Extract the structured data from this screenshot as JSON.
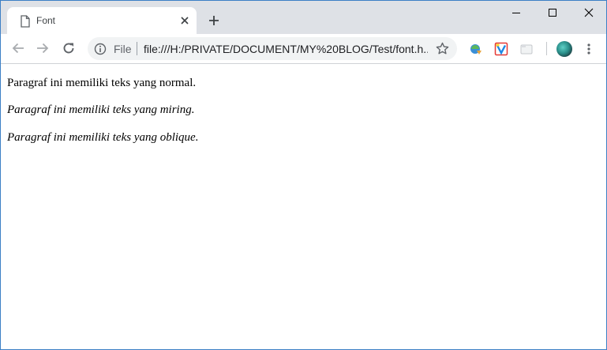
{
  "tab": {
    "title": "Font",
    "favicon": "document-icon"
  },
  "window_controls": [
    "minimize-icon",
    "maximize-icon",
    "close-icon"
  ],
  "toolbar": {
    "buttons": [
      "back-arrow-icon",
      "forward-arrow-icon",
      "reload-icon"
    ],
    "scheme_label": "File",
    "url": "file:///H:/PRIVATE/DOCUMENT/MY%20BLOG/Test/font.h...",
    "extensions": [
      "idm-extension-icon",
      "v-extension-icon",
      "tab-extension-icon"
    ]
  },
  "content": {
    "paragraphs": [
      "Paragraf ini memiliki teks yang normal.",
      "Paragraf ini memiliki teks yang miring.",
      "Paragraf ini memiliki teks yang oblique."
    ]
  },
  "colors": {
    "tabstrip": "#dee1e6",
    "omnibox": "#f1f3f4",
    "window_border": "#3c7fc6"
  }
}
